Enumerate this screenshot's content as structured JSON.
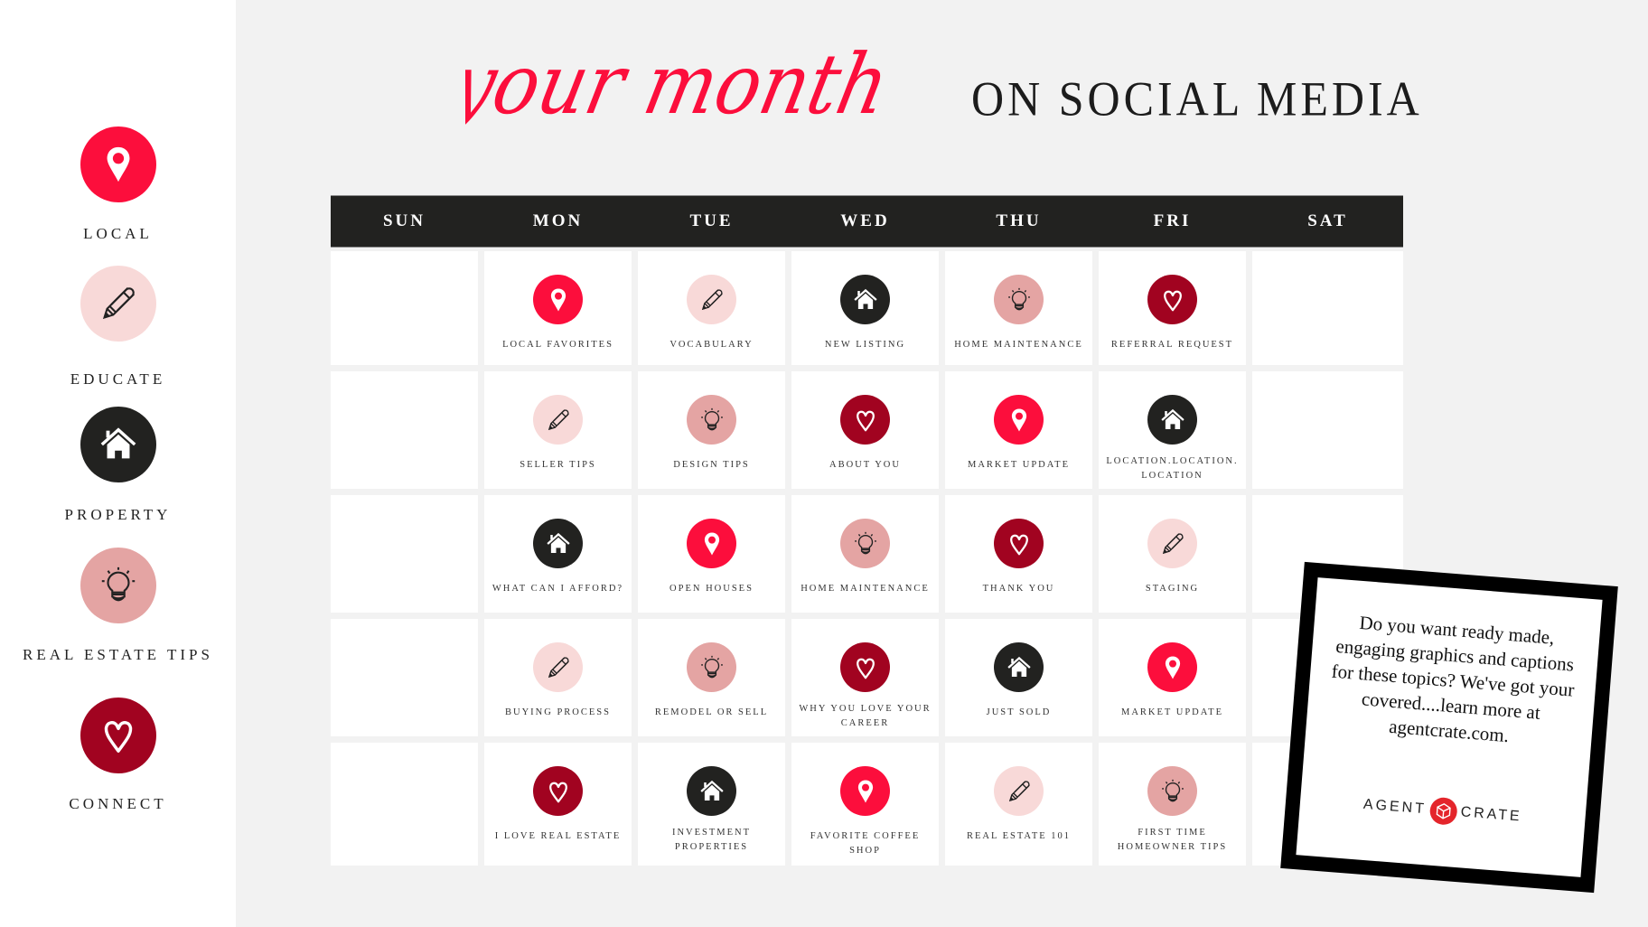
{
  "title": {
    "script_text": "your month",
    "serif_text": "ON SOCIAL MEDIA"
  },
  "colors": {
    "local": "#fc0e3c",
    "educate": "#f8d9d8",
    "property": "#222220",
    "tips": "#e4a4a3",
    "connect": "#a10320"
  },
  "legend": [
    {
      "category": "local",
      "icon": "map-pin-icon",
      "label": "LOCAL"
    },
    {
      "category": "educate",
      "icon": "pencil-icon",
      "label": "EDUCATE"
    },
    {
      "category": "property",
      "icon": "house-icon",
      "label": "PROPERTY"
    },
    {
      "category": "tips",
      "icon": "lightbulb-icon",
      "label": "REAL ESTATE TIPS"
    },
    {
      "category": "connect",
      "icon": "heart-icon",
      "label": "CONNECT"
    }
  ],
  "days": [
    "SUN",
    "MON",
    "TUE",
    "WED",
    "THU",
    "FRI",
    "SAT"
  ],
  "weeks": [
    [
      null,
      {
        "category": "local",
        "label": "LOCAL FAVORITES"
      },
      {
        "category": "educate",
        "label": "VOCABULARY"
      },
      {
        "category": "property",
        "label": "NEW LISTING"
      },
      {
        "category": "tips",
        "label": "HOME MAINTENANCE"
      },
      {
        "category": "connect",
        "label": "REFERRAL REQUEST"
      },
      null
    ],
    [
      null,
      {
        "category": "educate",
        "label": "SELLER TIPS"
      },
      {
        "category": "tips",
        "label": "DESIGN TIPS"
      },
      {
        "category": "connect",
        "label": "ABOUT YOU"
      },
      {
        "category": "local",
        "label": "MARKET UPDATE"
      },
      {
        "category": "property",
        "label": "LOCATION.LOCATION. LOCATION"
      },
      null
    ],
    [
      null,
      {
        "category": "property",
        "label": "WHAT CAN I AFFORD?"
      },
      {
        "category": "local",
        "label": "OPEN HOUSES"
      },
      {
        "category": "tips",
        "label": "HOME MAINTENANCE"
      },
      {
        "category": "connect",
        "label": "THANK YOU"
      },
      {
        "category": "educate",
        "label": "STAGING"
      },
      null
    ],
    [
      null,
      {
        "category": "educate",
        "label": "BUYING PROCESS"
      },
      {
        "category": "tips",
        "label": "REMODEL OR SELL"
      },
      {
        "category": "connect",
        "label": "WHY YOU LOVE YOUR CAREER"
      },
      {
        "category": "property",
        "label": "JUST SOLD"
      },
      {
        "category": "local",
        "label": "MARKET UPDATE"
      },
      null
    ],
    [
      null,
      {
        "category": "connect",
        "label": "I LOVE REAL ESTATE"
      },
      {
        "category": "property",
        "label": "INVESTMENT PROPERTIES"
      },
      {
        "category": "local",
        "label": "FAVORITE COFFEE SHOP"
      },
      {
        "category": "educate",
        "label": "REAL ESTATE 101"
      },
      {
        "category": "tips",
        "label": "FIRST TIME HOMEOWNER TIPS"
      },
      null
    ]
  ],
  "promo": {
    "text": "Do you want ready made, engaging graphics and captions for these topics? We've got your covered....learn more at agentcrate.com.",
    "logo_left": "AGENT",
    "logo_right": "CRATE"
  }
}
